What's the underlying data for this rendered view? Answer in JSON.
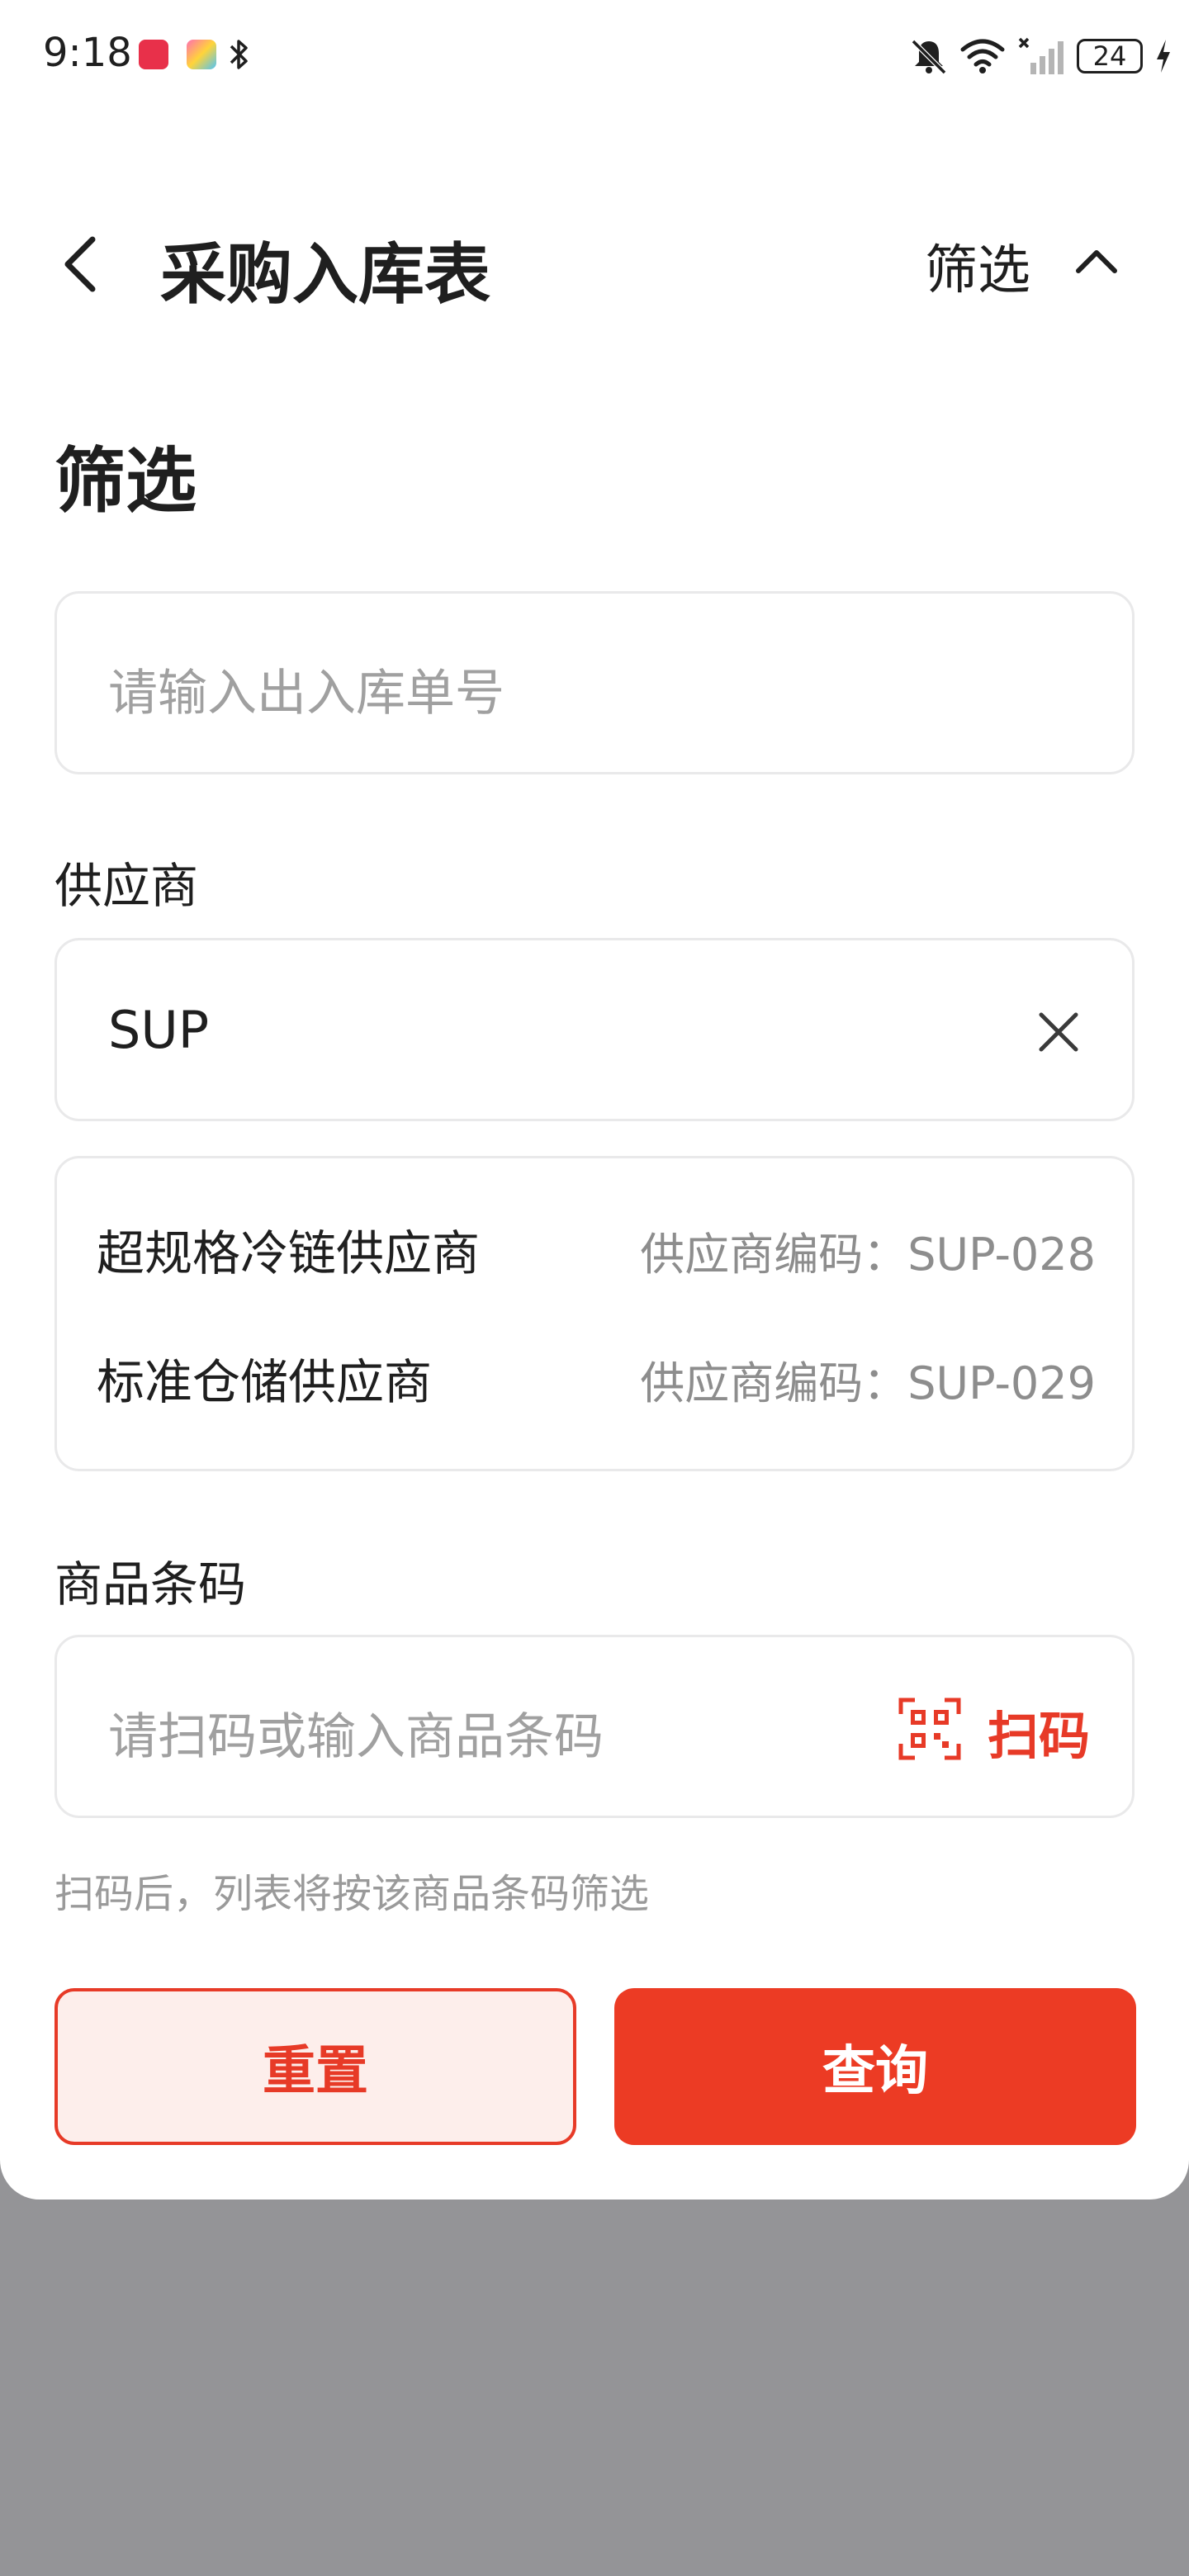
{
  "status_bar": {
    "time": "9:18",
    "battery": "24",
    "icons": [
      "xiaohongshu-badge-icon",
      "multicolor-app-icon",
      "bluetooth-icon",
      "bell-muted-icon",
      "wifi-icon",
      "cellular-off-icon",
      "battery-icon",
      "charging-icon"
    ]
  },
  "header": {
    "title": "采购入库表",
    "filter_label": "筛选"
  },
  "filter": {
    "section_title": "筛选",
    "order_input": {
      "placeholder": "请输入出入库单号",
      "value": ""
    },
    "supplier": {
      "label": "供应商",
      "value": "SUP",
      "options": [
        {
          "name": "超规格冷链供应商",
          "code_text": "供应商编码：SUP-028"
        },
        {
          "name": "标准仓储供应商",
          "code_text": "供应商编码：SUP-029"
        }
      ]
    },
    "barcode": {
      "label": "商品条码",
      "placeholder": "请扫码或输入商品条码",
      "scan_label": "扫码",
      "helper": "扫码后，列表将按该商品条码筛选"
    }
  },
  "actions": {
    "reset": "重置",
    "query": "查询"
  },
  "colors": {
    "accent": "#e73a27",
    "accent_bg": "#fdeeeb",
    "overlay": "#949497"
  }
}
